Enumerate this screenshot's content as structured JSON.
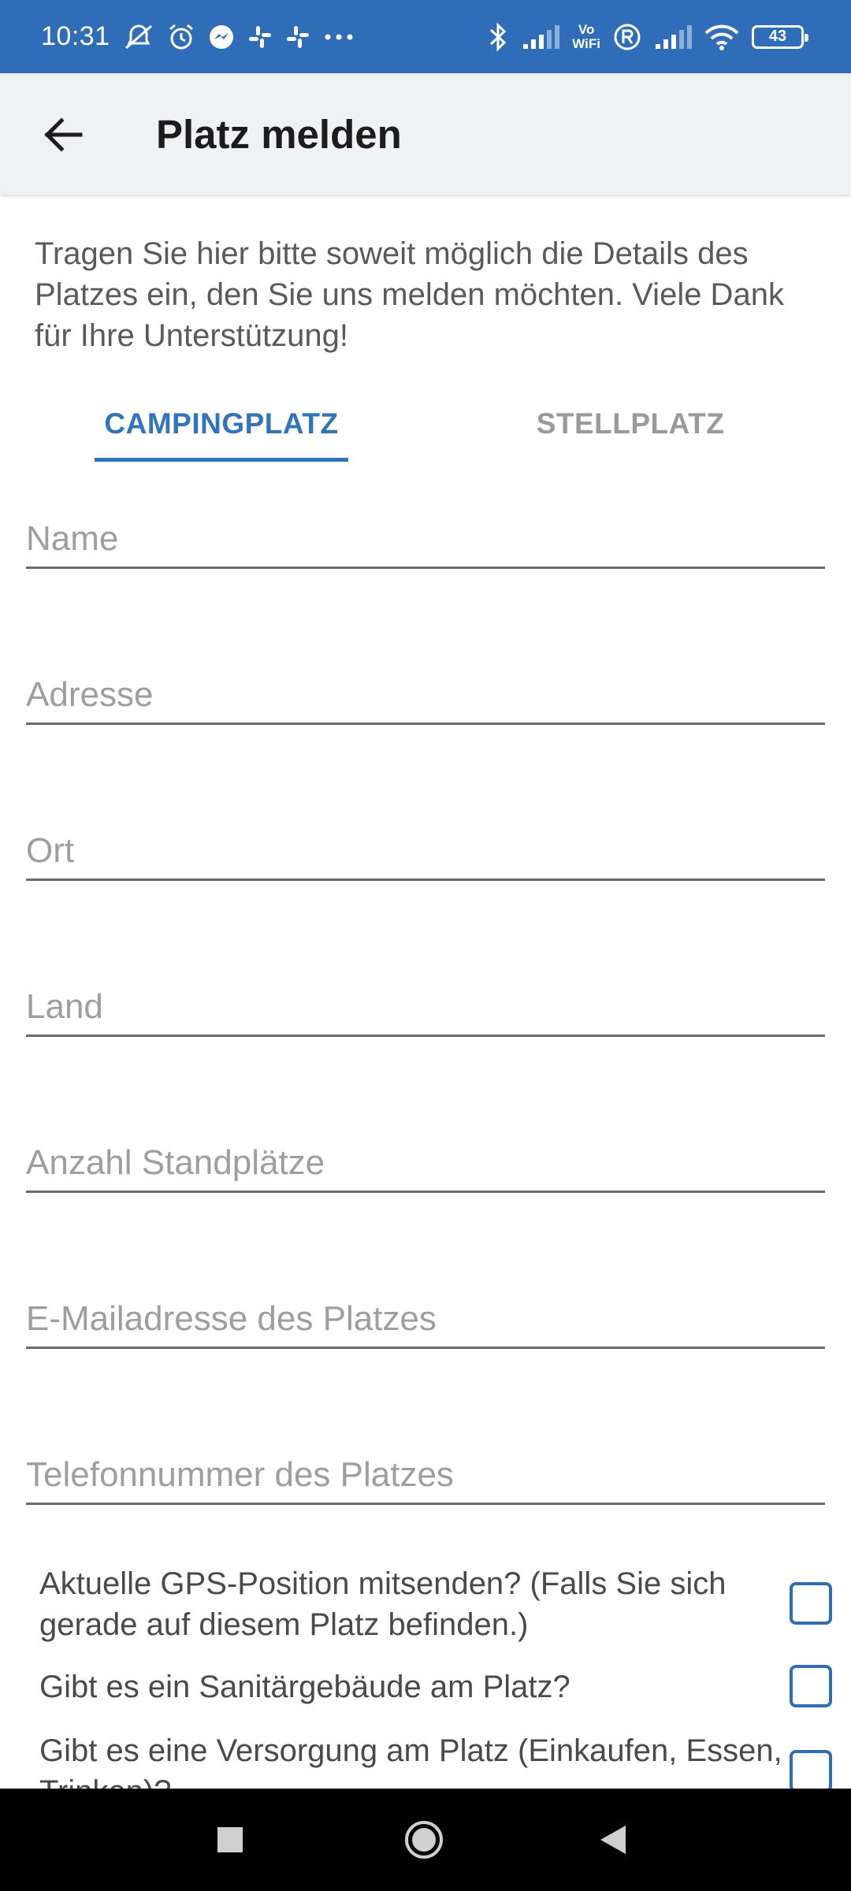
{
  "status_bar": {
    "time": "10:31",
    "battery": "43",
    "vowifi_top": "Vo",
    "vowifi_bottom": "WiFi",
    "icons_left": [
      "muted-bell-icon",
      "alarm-icon",
      "messenger-icon",
      "slack-icon",
      "slack-icon",
      "more-dots-icon"
    ],
    "icons_right": [
      "bluetooth-icon",
      "signal-icon",
      "vowifi-icon",
      "roaming-icon",
      "signal-icon",
      "wifi-icon",
      "battery-icon"
    ]
  },
  "app_bar": {
    "title": "Platz melden",
    "back_icon": "arrow-left-icon"
  },
  "intro": "Tragen Sie hier bitte soweit möglich die Details des Platzes ein, den Sie uns melden möchten. Viele Dank für Ihre Unterstützung!",
  "tabs": [
    {
      "label": "CAMPINGPLATZ",
      "active": true
    },
    {
      "label": "STELLPLATZ",
      "active": false
    }
  ],
  "fields": [
    {
      "placeholder": "Name",
      "value": ""
    },
    {
      "placeholder": "Adresse",
      "value": ""
    },
    {
      "placeholder": "Ort",
      "value": ""
    },
    {
      "placeholder": "Land",
      "value": ""
    },
    {
      "placeholder": "Anzahl Standplätze",
      "value": ""
    },
    {
      "placeholder": "E-Mailadresse des Platzes",
      "value": ""
    },
    {
      "placeholder": "Telefonnummer des Platzes",
      "value": ""
    }
  ],
  "checks": [
    {
      "label": "Aktuelle GPS-Position mitsenden? (Falls Sie sich gerade auf diesem Platz befinden.)",
      "checked": false
    },
    {
      "label": "Gibt es ein Sanitärgebäude am Platz?",
      "checked": false
    },
    {
      "label": "Gibt es eine Versorgung am Platz (Einkaufen, Essen, Trinken)?",
      "checked": false
    }
  ],
  "colors": {
    "status_bar": "#2f6db8",
    "accent": "#3273bd",
    "app_bar": "#f0f1f4"
  }
}
